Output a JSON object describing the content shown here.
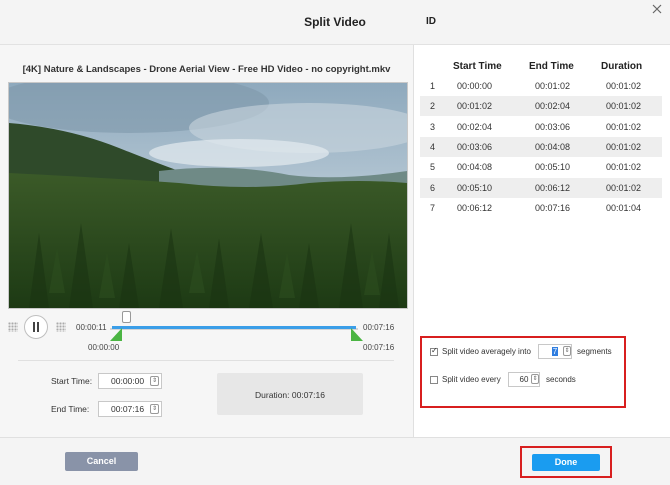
{
  "dialog": {
    "title": "Split Video"
  },
  "player": {
    "filename": "[4K] Nature & Landscapes - Drone Aerial View - Free HD Video - no copyright.mkv",
    "current_time": "00:00:11",
    "range_start": "00:00:00",
    "range_end_top": "00:07:16",
    "range_end_bottom": "00:07:16"
  },
  "trim": {
    "start_label": "Start Time:",
    "start_value": "00:00:00",
    "end_label": "End Time:",
    "end_value": "00:07:16",
    "duration_label": "Duration:",
    "duration_value": "00:07:16"
  },
  "table": {
    "headers": [
      "ID",
      "Start Time",
      "End Time",
      "Duration"
    ],
    "rows": [
      [
        "1",
        "00:00:00",
        "00:01:02",
        "00:01:02"
      ],
      [
        "2",
        "00:01:02",
        "00:02:04",
        "00:01:02"
      ],
      [
        "3",
        "00:02:04",
        "00:03:06",
        "00:01:02"
      ],
      [
        "4",
        "00:03:06",
        "00:04:08",
        "00:01:02"
      ],
      [
        "5",
        "00:04:08",
        "00:05:10",
        "00:01:02"
      ],
      [
        "6",
        "00:05:10",
        "00:06:12",
        "00:01:02"
      ],
      [
        "7",
        "00:06:12",
        "00:07:16",
        "00:01:04"
      ]
    ]
  },
  "options": {
    "avg": {
      "checked": true,
      "prefix": "Split video averagely into",
      "value": "7",
      "suffix": "segments"
    },
    "every": {
      "checked": false,
      "prefix": "Split video every",
      "value": "60",
      "suffix": "seconds"
    }
  },
  "footer": {
    "cancel_label": "Cancel",
    "done_label": "Done"
  },
  "colors": {
    "accent": "#1a9cf0",
    "highlight": "#d81f1f",
    "cancel": "#8993a8",
    "trim_handle": "#4bb543",
    "track": "#3b9ee8"
  }
}
